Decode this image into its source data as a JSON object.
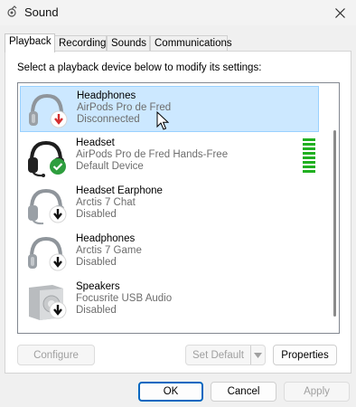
{
  "window": {
    "title": "Sound"
  },
  "tabs": [
    {
      "label": "Playback",
      "active": true
    },
    {
      "label": "Recording",
      "active": false
    },
    {
      "label": "Sounds",
      "active": false
    },
    {
      "label": "Communications",
      "active": false
    }
  ],
  "instruction": "Select a playback device below to modify its settings:",
  "devices": [
    {
      "name": "Headphones",
      "device": "AirPods Pro de Fred",
      "status": "Disconnected",
      "icon": "headphones-icon",
      "badge": "disconnected-badge-icon",
      "selected": true
    },
    {
      "name": "Headset",
      "device": "AirPods Pro de Fred Hands-Free",
      "status": "Default Device",
      "icon": "headset-icon",
      "badge": "default-check-badge-icon",
      "selected": false
    },
    {
      "name": "Headset Earphone",
      "device": "Arctis 7 Chat",
      "status": "Disabled",
      "icon": "headset-icon",
      "badge": "disabled-badge-icon",
      "selected": false
    },
    {
      "name": "Headphones",
      "device": "Arctis 7 Game",
      "status": "Disabled",
      "icon": "headphones-icon",
      "badge": "disabled-badge-icon",
      "selected": false
    },
    {
      "name": "Speakers",
      "device": "Focusrite USB Audio",
      "status": "Disabled",
      "icon": "speaker-icon",
      "badge": "disabled-badge-icon",
      "selected": false
    }
  ],
  "panel_buttons": {
    "configure": "Configure",
    "set_default": "Set Default",
    "properties": "Properties"
  },
  "dialog_buttons": {
    "ok": "OK",
    "cancel": "Cancel",
    "apply": "Apply"
  },
  "colors": {
    "selection": "#cce8ff",
    "accent": "#0067c0",
    "level_meter": "#20b020",
    "disconnected": "#d32f2f",
    "default_check": "#2e9e3e"
  }
}
